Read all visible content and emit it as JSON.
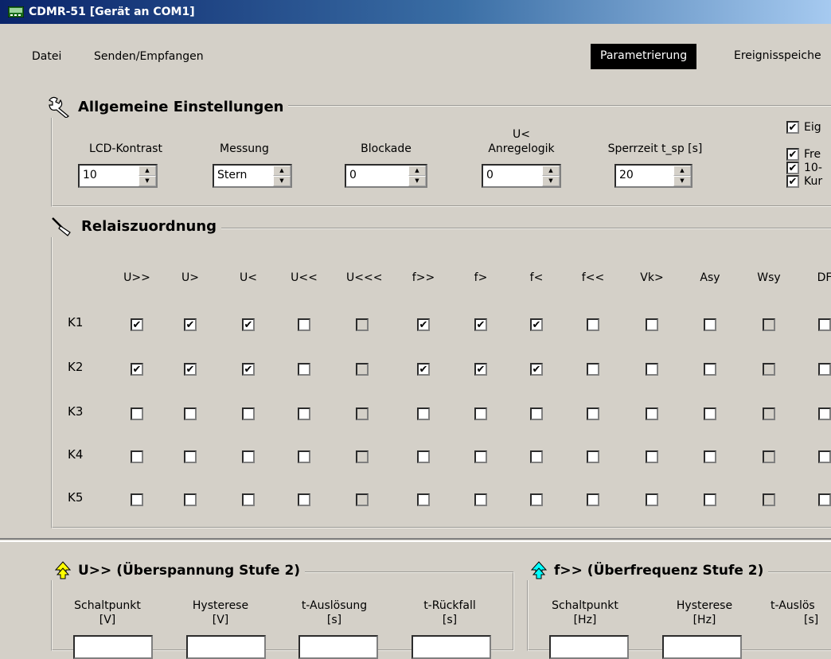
{
  "window": {
    "title": "CDMR-51 [Gerät an COM1]"
  },
  "menu": {
    "items": [
      "Datei",
      "Senden/Empfangen"
    ]
  },
  "views": {
    "active": "Parametrierung",
    "next": "Ereignisspeiche"
  },
  "general": {
    "title": "Allgemeine Einstellungen",
    "lcd": {
      "label": "LCD-Kontrast",
      "value": "10"
    },
    "messung": {
      "label": "Messung",
      "value": "Stern"
    },
    "blockade": {
      "label": "Blockade",
      "value": "0"
    },
    "anregelogik": {
      "label_line1": "U<",
      "label_line2": "Anregelogik",
      "value": "0"
    },
    "sperrzeit": {
      "label": "Sperrzeit t_sp [s]",
      "value": "20"
    },
    "options": [
      "Eig",
      "Fre",
      "10-",
      "Kur"
    ]
  },
  "relay": {
    "title": "Relaiszuordnung",
    "columns": [
      "U>>",
      "U>",
      "U<",
      "U<<",
      "U<<<",
      "f>>",
      "f>",
      "f<",
      "f<<",
      "Vk>",
      "Asy",
      "Wsy",
      "DF"
    ],
    "rows": [
      {
        "label": "K1",
        "checks": [
          true,
          true,
          true,
          false,
          false,
          true,
          true,
          true,
          false,
          false,
          false,
          false,
          false
        ]
      },
      {
        "label": "K2",
        "checks": [
          true,
          true,
          true,
          false,
          false,
          true,
          true,
          true,
          false,
          false,
          false,
          false,
          false
        ]
      },
      {
        "label": "K3",
        "checks": [
          false,
          false,
          false,
          false,
          false,
          false,
          false,
          false,
          false,
          false,
          false,
          false,
          false
        ]
      },
      {
        "label": "K4",
        "checks": [
          false,
          false,
          false,
          false,
          false,
          false,
          false,
          false,
          false,
          false,
          false,
          false,
          false
        ]
      },
      {
        "label": "K5",
        "checks": [
          false,
          false,
          false,
          false,
          false,
          false,
          false,
          false,
          false,
          false,
          false,
          false,
          false
        ]
      }
    ],
    "disabled_columns": [
      4,
      11
    ]
  },
  "u_stage": {
    "title": "U>> (Überspannung Stufe 2)",
    "fields": [
      {
        "line1": "Schaltpunkt",
        "line2": "[V]"
      },
      {
        "line1": "Hysterese",
        "line2": "[V]"
      },
      {
        "line1": "t-Auslösung",
        "line2": "[s]"
      },
      {
        "line1": "t-Rückfall",
        "line2": "[s]"
      }
    ]
  },
  "f_stage": {
    "title": "f>> (Überfrequenz Stufe 2)",
    "fields": [
      {
        "line1": "Schaltpunkt",
        "line2": "[Hz]"
      },
      {
        "line1": "Hysterese",
        "line2": "[Hz]"
      },
      {
        "line1": "t-Auslös",
        "line2": "[s]"
      }
    ]
  }
}
